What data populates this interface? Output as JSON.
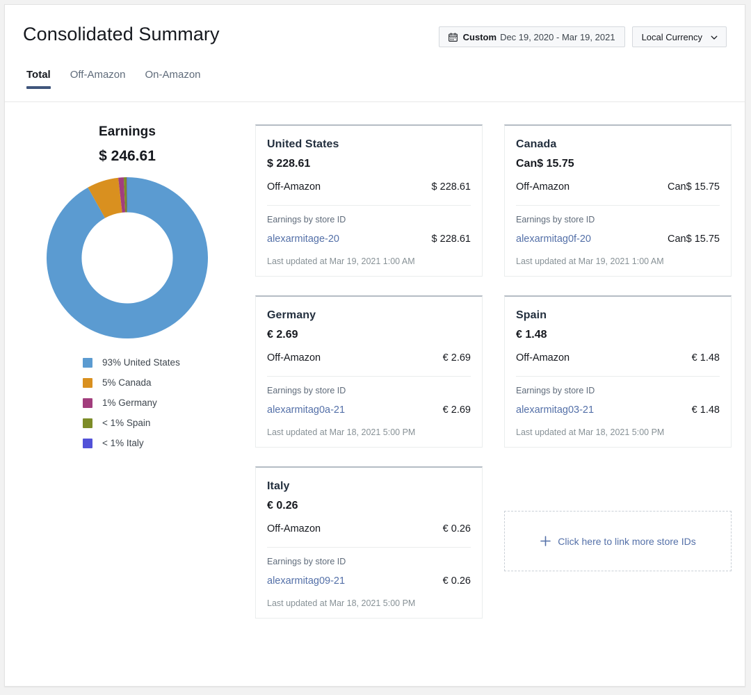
{
  "header": {
    "title": "Consolidated Summary",
    "date_picker": {
      "icon": "calendar-icon",
      "label": "Custom",
      "range": "Dec 19, 2020 - Mar 19, 2021"
    },
    "currency_selector": {
      "label": "Local Currency",
      "icon": "chevron-down-icon"
    }
  },
  "tabs": [
    {
      "label": "Total",
      "active": true
    },
    {
      "label": "Off-Amazon",
      "active": false
    },
    {
      "label": "On-Amazon",
      "active": false
    }
  ],
  "earnings": {
    "title": "Earnings",
    "total": "$ 246.61"
  },
  "chart_data": {
    "type": "pie",
    "title": "Earnings",
    "subtitle": "$ 246.61",
    "variant": "donut",
    "start_angle_deg": 0,
    "direction": "clockwise",
    "inner_radius_ratio": 0.565,
    "legend_position": "bottom-left",
    "categories": [
      "United States",
      "Canada",
      "Germany",
      "Spain",
      "Italy"
    ],
    "values": [
      228.61,
      15.75,
      2.69,
      1.48,
      0.26
    ],
    "percent_labels": [
      "93%",
      "5%",
      "1%",
      "< 1%",
      "< 1%"
    ],
    "percents": [
      92.7,
      6.39,
      1.09,
      0.6,
      0.11
    ],
    "colors": [
      "#5b9bd1",
      "#d9901f",
      "#a23e7d",
      "#7d8c28",
      "#5252d8"
    ],
    "legend": [
      {
        "label": "93% United States",
        "color": "#5b9bd1"
      },
      {
        "label": "5% Canada",
        "color": "#d9901f"
      },
      {
        "label": "1% Germany",
        "color": "#a23e7d"
      },
      {
        "label": "< 1% Spain",
        "color": "#7d8c28"
      },
      {
        "label": "< 1% Italy",
        "color": "#5252d8"
      }
    ]
  },
  "cards": [
    {
      "country": "United States",
      "amount": "$ 228.61",
      "channel_label": "Off-Amazon",
      "channel_amount": "$ 228.61",
      "store_section_label": "Earnings by store ID",
      "store_id": "alexarmitage-20",
      "store_amount": "$ 228.61",
      "updated": "Last updated at Mar 19, 2021 1:00 AM"
    },
    {
      "country": "Canada",
      "amount": "Can$ 15.75",
      "channel_label": "Off-Amazon",
      "channel_amount": "Can$ 15.75",
      "store_section_label": "Earnings by store ID",
      "store_id": "alexarmitag0f-20",
      "store_amount": "Can$ 15.75",
      "updated": "Last updated at Mar 19, 2021 1:00 AM"
    },
    {
      "country": "Germany",
      "amount": "€ 2.69",
      "channel_label": "Off-Amazon",
      "channel_amount": "€ 2.69",
      "store_section_label": "Earnings by store ID",
      "store_id": "alexarmitag0a-21",
      "store_amount": "€ 2.69",
      "updated": "Last updated at Mar 18, 2021 5:00 PM"
    },
    {
      "country": "Spain",
      "amount": "€ 1.48",
      "channel_label": "Off-Amazon",
      "channel_amount": "€ 1.48",
      "store_section_label": "Earnings by store ID",
      "store_id": "alexarmitag03-21",
      "store_amount": "€ 1.48",
      "updated": "Last updated at Mar 18, 2021 5:00 PM"
    },
    {
      "country": "Italy",
      "amount": "€ 0.26",
      "channel_label": "Off-Amazon",
      "channel_amount": "€ 0.26",
      "store_section_label": "Earnings by store ID",
      "store_id": "alexarmitag09-21",
      "store_amount": "€ 0.26",
      "updated": "Last updated at Mar 18, 2021 5:00 PM"
    }
  ],
  "link_more": {
    "icon": "plus-icon",
    "label": "Click here to link more store IDs"
  },
  "theme": {
    "accent": "#40567c",
    "link": "#5470a8",
    "text": "#16191f",
    "muted": "#5f6b7a"
  }
}
